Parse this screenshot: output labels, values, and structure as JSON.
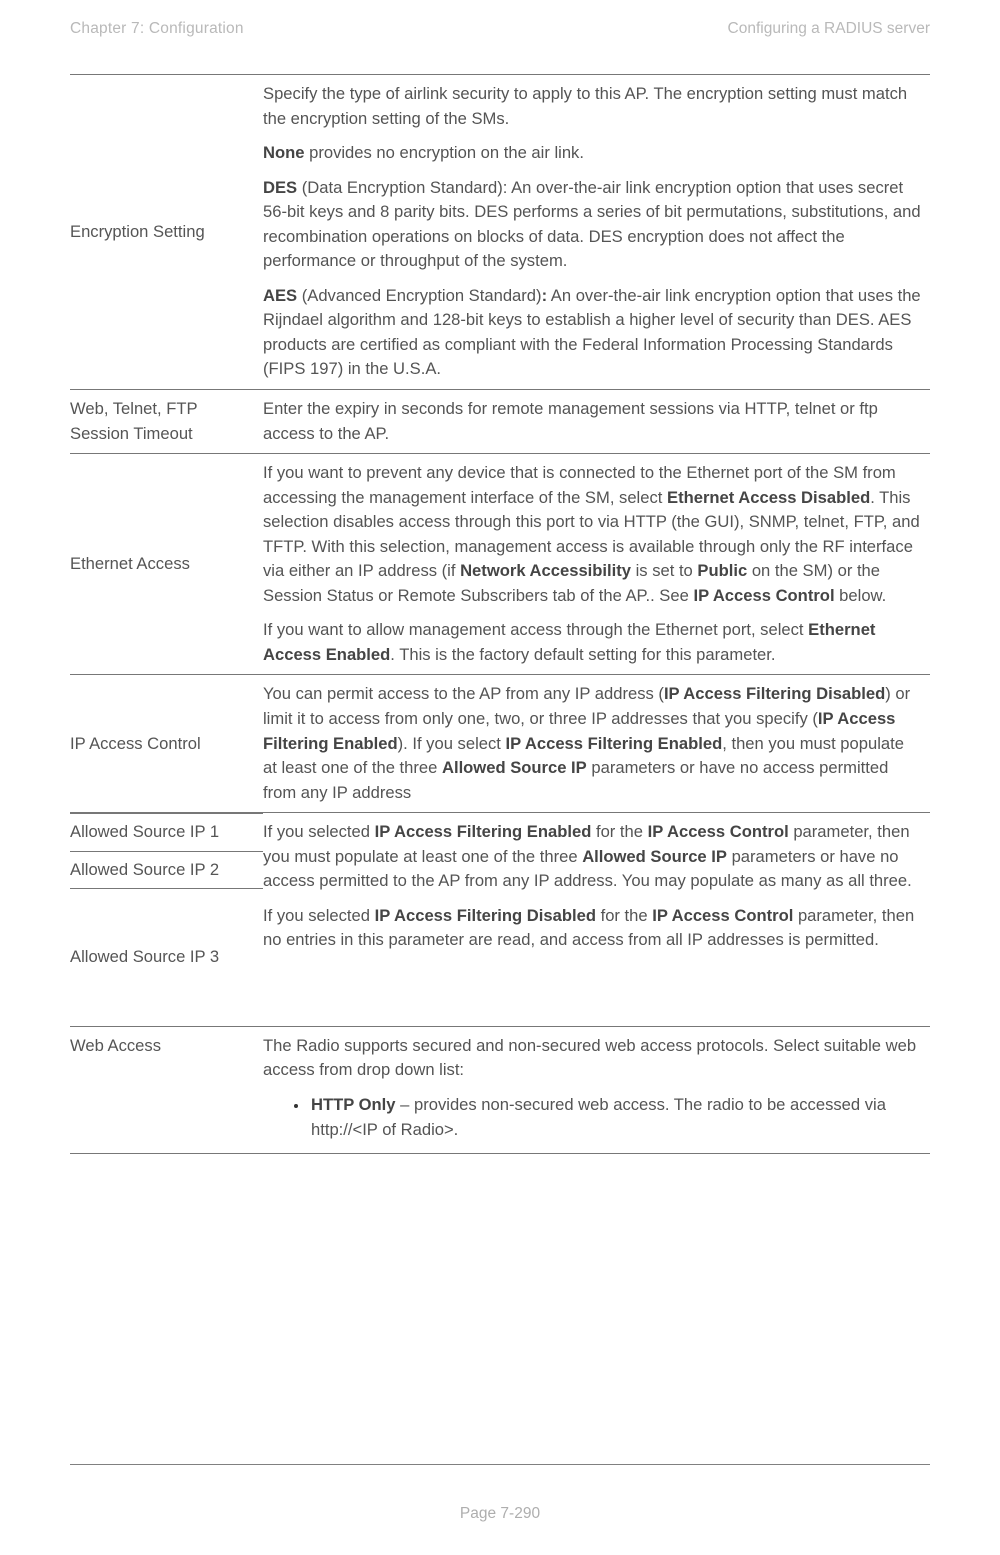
{
  "header": {
    "left": "Chapter 7:  Configuration",
    "right": "Configuring a RADIUS server"
  },
  "footer": {
    "text": "Page 7-290"
  },
  "rows": {
    "encryption": {
      "label": "Encryption Setting",
      "p1": "Specify the type of airlink security to apply to this AP. The encryption setting must match the encryption setting of the SMs.",
      "p2a": "None",
      "p2b": " provides no encryption on the air link.",
      "p3a": "DES",
      "p3b": " (Data Encryption Standard): An over-the-air link encryption option that uses secret 56-bit keys and 8 parity bits. DES performs a series of bit permutations, substitutions, and recombination operations on blocks of data. DES encryption does not affect the performance or throughput of the system.",
      "p4a": "AES",
      "p4b": " (Advanced Encryption Standard)",
      "p4c": ":",
      "p4d": " An over-the-air link encryption option that uses the Rijndael algorithm and 128-bit keys to establish a higher level of security than DES. AES products are certified as compliant with the Federal Information Processing Standards (FIPS 197) in the U.S.A."
    },
    "session_timeout": {
      "label": "Web, Telnet, FTP Session Timeout",
      "p1": "Enter the expiry in seconds for remote management sessions via HTTP, telnet or ftp access to the AP."
    },
    "ethernet_access": {
      "label": "Ethernet Access",
      "p1a": "If you want to prevent any device that is connected to the Ethernet port of the SM from accessing the management interface of the SM, select ",
      "p1b": "Ethernet Access Disabled",
      "p1c": ". This selection disables access through this port to via HTTP (the GUI), SNMP, telnet, FTP, and TFTP. With this selection, management access is available through only the RF interface via either an IP address (if ",
      "p1d": "Network Accessibility",
      "p1e": " is set to ",
      "p1f": "Public",
      "p1g": " on the SM) or the Session Status or Remote Subscribers tab of the AP.. See ",
      "p1h": "IP Access Control",
      "p1i": " below.",
      "p2a": "If you want to allow management access through the Ethernet port, select ",
      "p2b": "Ethernet Access Enabled",
      "p2c": ". This is the factory default setting for this parameter."
    },
    "ip_access_control": {
      "label": "IP Access Control",
      "p1a": "You can permit access to the AP from any IP address (",
      "p1b": "IP Access Filtering Disabled",
      "p1c": ") or limit it to access from only one, two, or three IP addresses that you specify (",
      "p1d": "IP Access Filtering Enabled",
      "p1e": "). If you select ",
      "p1f": "IP Access Filtering Enabled",
      "p1g": ", then you must populate at least one of the three ",
      "p1h": "Allowed Source IP",
      "p1i": " parameters or have no access permitted from any IP address"
    },
    "allowed_ip": {
      "label1": "Allowed Source IP 1",
      "label2": "Allowed Source IP 2",
      "label3": "Allowed Source IP 3",
      "p1a": "If you selected ",
      "p1b": "IP Access Filtering Enabled",
      "p1c": " for the ",
      "p1d": "IP Access Control",
      "p1e": " parameter, then you must populate at least one of the three ",
      "p1f": "Allowed Source IP",
      "p1g": " parameters or have no access permitted to the AP from any IP address. You may populate as many as all three.",
      "p2a": "If you selected ",
      "p2b": "IP Access Filtering Disabled",
      "p2c": " for the ",
      "p2d": "IP Access Control",
      "p2e": " parameter, then no entries in this parameter are read, and access from all IP addresses is permitted."
    },
    "web_access": {
      "label": "Web Access",
      "p1": "The Radio supports secured and non-secured web access protocols. Select suitable web access from drop down list:",
      "b1a": "HTTP Only",
      "b1b": " – provides non-secured web access. The radio to be accessed via http://<IP of Radio>."
    }
  }
}
